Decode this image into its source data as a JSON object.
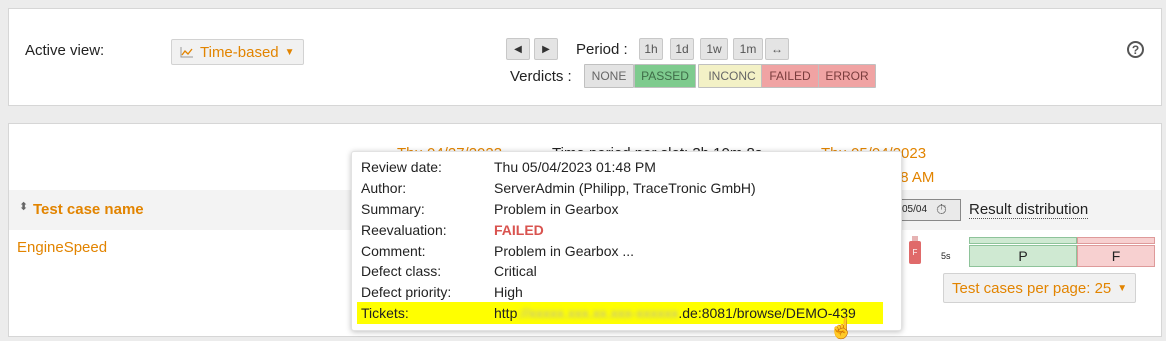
{
  "header": {
    "active_view_label": "Active view:",
    "view_button": "Time-based",
    "view_chevron": "▼",
    "period_label": "Period :",
    "period_buttons": [
      "1h",
      "1d",
      "1w",
      "1m",
      "↔"
    ],
    "nav_prev": "◀",
    "nav_next": "▶",
    "verdicts_label": "Verdicts :",
    "verdicts": [
      {
        "label": "NONE",
        "color": "#e3e3e3"
      },
      {
        "label": "PASSED",
        "color": "#7ecb8e"
      },
      {
        "label": "INCONC",
        "color": "#f3f1c6"
      },
      {
        "label": "FAILED",
        "color": "#f0a3a3"
      },
      {
        "label": "ERROR",
        "color": "#f0a3a3"
      }
    ],
    "help_icon": "?"
  },
  "table": {
    "start_date": "Thu 04/27/2023",
    "period_text": "Time period per slot: 3h 10m 8s",
    "end_date": "Thu 05/04/2023",
    "end_time": "01:48 AM",
    "sort_icon": "⬍",
    "column_name": "Test case name",
    "slot_date": "05/04",
    "column_result": "Result distribution",
    "rows": [
      {
        "name": "EngineSpeed",
        "bar_label": "F",
        "duration": "5s",
        "passed_label": "P",
        "failed_label": "F"
      }
    ],
    "pagination": "Test cases per page: 25",
    "pagination_chevron": "▼"
  },
  "tooltip": {
    "rows": [
      {
        "key": "Review date:",
        "value": "Thu 05/04/2023 01:48 PM"
      },
      {
        "key": "Author:",
        "value": "ServerAdmin (Philipp, TraceTronic GmbH)"
      },
      {
        "key": "Summary:",
        "value": "Problem in Gearbox"
      },
      {
        "key": "Reevaluation:",
        "value": "FAILED"
      },
      {
        "key": "Comment:",
        "value": "Problem in Gearbox ..."
      },
      {
        "key": "Defect class:",
        "value": "Critical"
      },
      {
        "key": "Defect priority:",
        "value": "High"
      }
    ],
    "tickets_key": "Tickets:",
    "tickets_prefix": "http",
    "tickets_blurred": "://xxxxx.xxx.xx.xxx-xxxxxx",
    "tickets_suffix": ".de:8081/browse/DEMO-439"
  },
  "colors": {
    "accent": "#e28400",
    "failed_text": "#d9534f",
    "highlight": "#ffff00"
  }
}
